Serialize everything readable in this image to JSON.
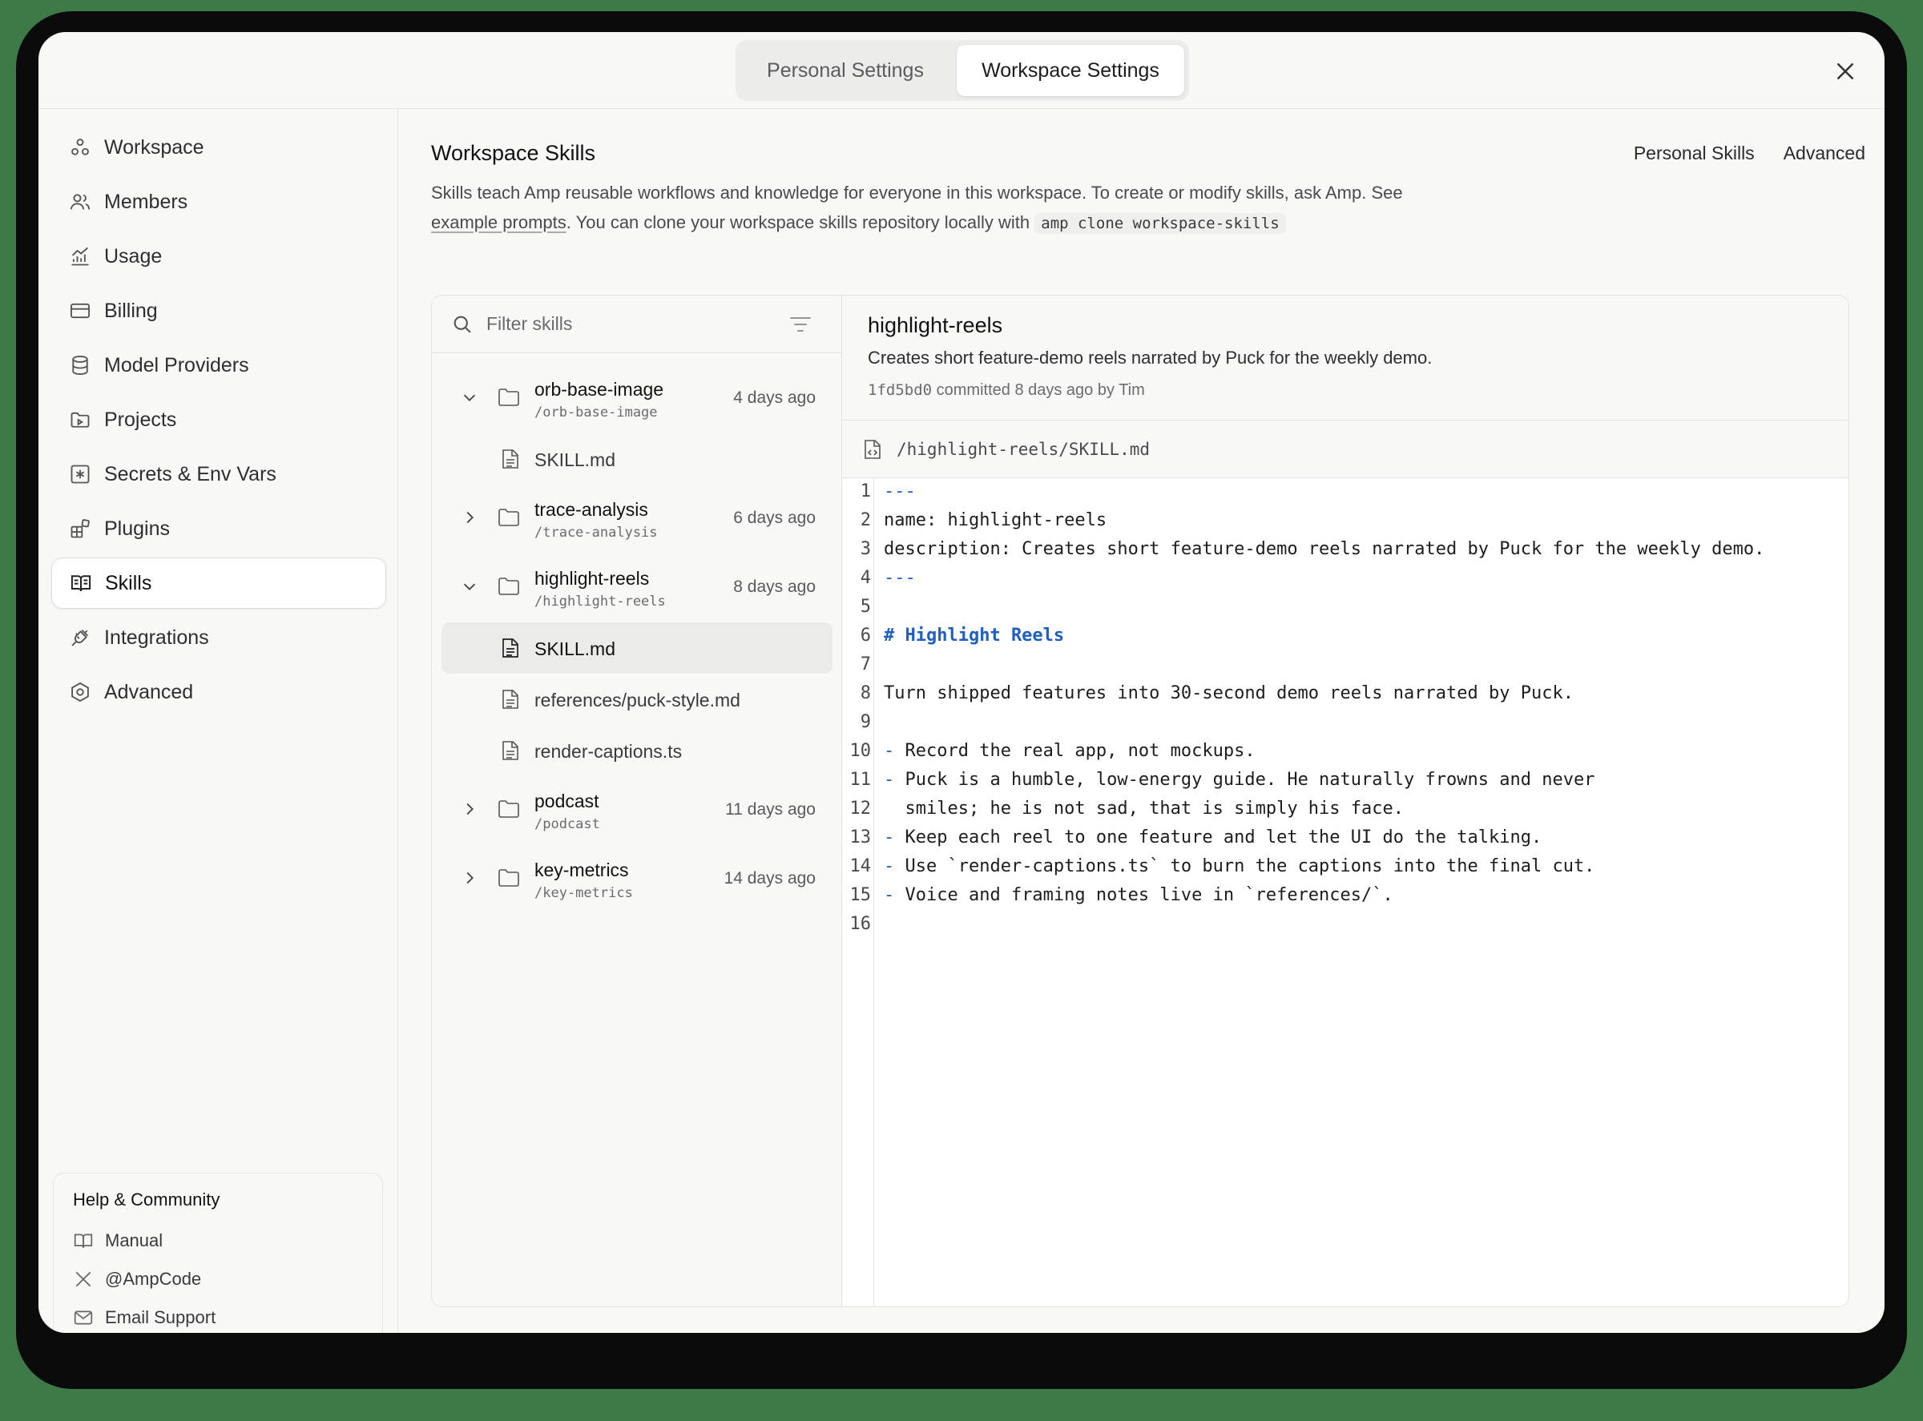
{
  "tabs": {
    "personal": "Personal Settings",
    "workspace": "Workspace Settings"
  },
  "sidebar": {
    "items": [
      {
        "label": "Workspace",
        "icon": "workspace-icon"
      },
      {
        "label": "Members",
        "icon": "members-icon"
      },
      {
        "label": "Usage",
        "icon": "usage-chart-icon"
      },
      {
        "label": "Billing",
        "icon": "billing-card-icon"
      },
      {
        "label": "Model Providers",
        "icon": "database-icon"
      },
      {
        "label": "Projects",
        "icon": "projects-folder-icon"
      },
      {
        "label": "Secrets & Env Vars",
        "icon": "secrets-asterisk-icon"
      },
      {
        "label": "Plugins",
        "icon": "plugins-grid-icon"
      },
      {
        "label": "Skills",
        "icon": "book-icon",
        "active": true
      },
      {
        "label": "Integrations",
        "icon": "plug-icon"
      },
      {
        "label": "Advanced",
        "icon": "advanced-hexagon-icon"
      }
    ],
    "help": {
      "title": "Help & Community",
      "items": [
        {
          "label": "Manual",
          "icon": "book-open-icon"
        },
        {
          "label": "@AmpCode",
          "icon": "x-logo-icon"
        },
        {
          "label": "Email Support",
          "icon": "mail-icon"
        }
      ]
    }
  },
  "main": {
    "title": "Workspace Skills",
    "links": {
      "personal": "Personal Skills",
      "advanced": "Advanced"
    },
    "description": {
      "part1": "Skills teach Amp reusable workflows and knowledge for everyone in this workspace. To create or modify skills, ask Amp. See",
      "link": "example prompts",
      "part2": ". You can clone your workspace skills repository locally with",
      "command": "amp clone workspace-skills"
    }
  },
  "tree": {
    "filter_placeholder": "Filter skills",
    "rows": [
      {
        "name": "orb-base-image",
        "path": "/orb-base-image",
        "age": "4 days ago"
      },
      {
        "file": "SKILL.md"
      },
      {
        "name": "trace-analysis",
        "path": "/trace-analysis",
        "age": "6 days ago"
      },
      {
        "name": "highlight-reels",
        "path": "/highlight-reels",
        "age": "8 days ago"
      },
      {
        "file": "SKILL.md"
      },
      {
        "file": "references/puck-style.md"
      },
      {
        "file": "render-captions.ts"
      },
      {
        "name": "podcast",
        "path": "/podcast",
        "age": "11 days ago"
      },
      {
        "name": "key-metrics",
        "path": "/key-metrics",
        "age": "14 days ago"
      }
    ]
  },
  "detail": {
    "title": "highlight-reels",
    "subtitle": "Creates short feature-demo reels narrated by Puck for the weekly demo.",
    "hash": "1fd5bd0",
    "committed": "committed",
    "age": "8 days ago",
    "by": "by Tim",
    "file_path": "/highlight-reels/SKILL.md",
    "line_numbers": [
      "1",
      "2",
      "3",
      "4",
      "5",
      "6",
      "7",
      "8",
      "9",
      "10",
      "11",
      "12",
      "13",
      "14",
      "15",
      "16"
    ],
    "lines": {
      "l1": "---",
      "l2": "name: highlight-reels",
      "l3": "description: Creates short feature-demo reels narrated by Puck for the weekly demo.",
      "l4": "---",
      "l6": "# Highlight Reels",
      "l8": "Turn shipped features into 30-second demo reels narrated by Puck.",
      "dash": "-",
      "l10": " Record the real app, not mockups.",
      "l11": " Puck is a humble, low-energy guide. He naturally frowns and never",
      "l12": "  smiles; he is not sad, that is simply his face.",
      "l13": " Keep each reel to one feature and let the UI do the talking.",
      "l14": " Use `render-captions.ts` to burn the captions into the final cut.",
      "l15": " Voice and framing notes live in `references/`."
    }
  }
}
